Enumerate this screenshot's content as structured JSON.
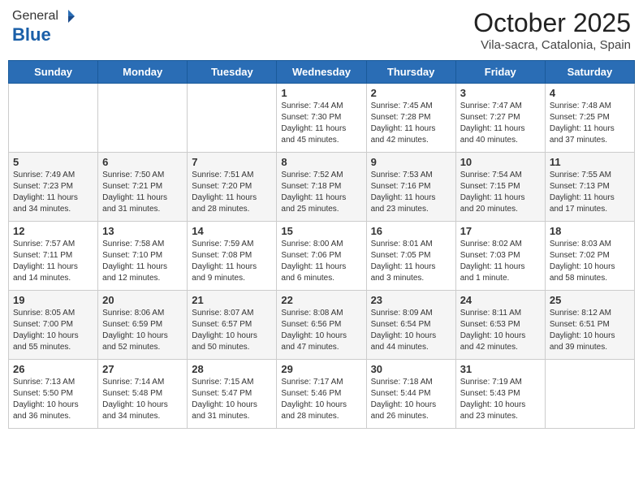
{
  "header": {
    "logo_general": "General",
    "logo_blue": "Blue",
    "month_title": "October 2025",
    "location": "Vila-sacra, Catalonia, Spain"
  },
  "weekdays": [
    "Sunday",
    "Monday",
    "Tuesday",
    "Wednesday",
    "Thursday",
    "Friday",
    "Saturday"
  ],
  "weeks": [
    [
      {
        "day": "",
        "info": ""
      },
      {
        "day": "",
        "info": ""
      },
      {
        "day": "",
        "info": ""
      },
      {
        "day": "1",
        "info": "Sunrise: 7:44 AM\nSunset: 7:30 PM\nDaylight: 11 hours and 45 minutes."
      },
      {
        "day": "2",
        "info": "Sunrise: 7:45 AM\nSunset: 7:28 PM\nDaylight: 11 hours and 42 minutes."
      },
      {
        "day": "3",
        "info": "Sunrise: 7:47 AM\nSunset: 7:27 PM\nDaylight: 11 hours and 40 minutes."
      },
      {
        "day": "4",
        "info": "Sunrise: 7:48 AM\nSunset: 7:25 PM\nDaylight: 11 hours and 37 minutes."
      }
    ],
    [
      {
        "day": "5",
        "info": "Sunrise: 7:49 AM\nSunset: 7:23 PM\nDaylight: 11 hours and 34 minutes."
      },
      {
        "day": "6",
        "info": "Sunrise: 7:50 AM\nSunset: 7:21 PM\nDaylight: 11 hours and 31 minutes."
      },
      {
        "day": "7",
        "info": "Sunrise: 7:51 AM\nSunset: 7:20 PM\nDaylight: 11 hours and 28 minutes."
      },
      {
        "day": "8",
        "info": "Sunrise: 7:52 AM\nSunset: 7:18 PM\nDaylight: 11 hours and 25 minutes."
      },
      {
        "day": "9",
        "info": "Sunrise: 7:53 AM\nSunset: 7:16 PM\nDaylight: 11 hours and 23 minutes."
      },
      {
        "day": "10",
        "info": "Sunrise: 7:54 AM\nSunset: 7:15 PM\nDaylight: 11 hours and 20 minutes."
      },
      {
        "day": "11",
        "info": "Sunrise: 7:55 AM\nSunset: 7:13 PM\nDaylight: 11 hours and 17 minutes."
      }
    ],
    [
      {
        "day": "12",
        "info": "Sunrise: 7:57 AM\nSunset: 7:11 PM\nDaylight: 11 hours and 14 minutes."
      },
      {
        "day": "13",
        "info": "Sunrise: 7:58 AM\nSunset: 7:10 PM\nDaylight: 11 hours and 12 minutes."
      },
      {
        "day": "14",
        "info": "Sunrise: 7:59 AM\nSunset: 7:08 PM\nDaylight: 11 hours and 9 minutes."
      },
      {
        "day": "15",
        "info": "Sunrise: 8:00 AM\nSunset: 7:06 PM\nDaylight: 11 hours and 6 minutes."
      },
      {
        "day": "16",
        "info": "Sunrise: 8:01 AM\nSunset: 7:05 PM\nDaylight: 11 hours and 3 minutes."
      },
      {
        "day": "17",
        "info": "Sunrise: 8:02 AM\nSunset: 7:03 PM\nDaylight: 11 hours and 1 minute."
      },
      {
        "day": "18",
        "info": "Sunrise: 8:03 AM\nSunset: 7:02 PM\nDaylight: 10 hours and 58 minutes."
      }
    ],
    [
      {
        "day": "19",
        "info": "Sunrise: 8:05 AM\nSunset: 7:00 PM\nDaylight: 10 hours and 55 minutes."
      },
      {
        "day": "20",
        "info": "Sunrise: 8:06 AM\nSunset: 6:59 PM\nDaylight: 10 hours and 52 minutes."
      },
      {
        "day": "21",
        "info": "Sunrise: 8:07 AM\nSunset: 6:57 PM\nDaylight: 10 hours and 50 minutes."
      },
      {
        "day": "22",
        "info": "Sunrise: 8:08 AM\nSunset: 6:56 PM\nDaylight: 10 hours and 47 minutes."
      },
      {
        "day": "23",
        "info": "Sunrise: 8:09 AM\nSunset: 6:54 PM\nDaylight: 10 hours and 44 minutes."
      },
      {
        "day": "24",
        "info": "Sunrise: 8:11 AM\nSunset: 6:53 PM\nDaylight: 10 hours and 42 minutes."
      },
      {
        "day": "25",
        "info": "Sunrise: 8:12 AM\nSunset: 6:51 PM\nDaylight: 10 hours and 39 minutes."
      }
    ],
    [
      {
        "day": "26",
        "info": "Sunrise: 7:13 AM\nSunset: 5:50 PM\nDaylight: 10 hours and 36 minutes."
      },
      {
        "day": "27",
        "info": "Sunrise: 7:14 AM\nSunset: 5:48 PM\nDaylight: 10 hours and 34 minutes."
      },
      {
        "day": "28",
        "info": "Sunrise: 7:15 AM\nSunset: 5:47 PM\nDaylight: 10 hours and 31 minutes."
      },
      {
        "day": "29",
        "info": "Sunrise: 7:17 AM\nSunset: 5:46 PM\nDaylight: 10 hours and 28 minutes."
      },
      {
        "day": "30",
        "info": "Sunrise: 7:18 AM\nSunset: 5:44 PM\nDaylight: 10 hours and 26 minutes."
      },
      {
        "day": "31",
        "info": "Sunrise: 7:19 AM\nSunset: 5:43 PM\nDaylight: 10 hours and 23 minutes."
      },
      {
        "day": "",
        "info": ""
      }
    ]
  ]
}
